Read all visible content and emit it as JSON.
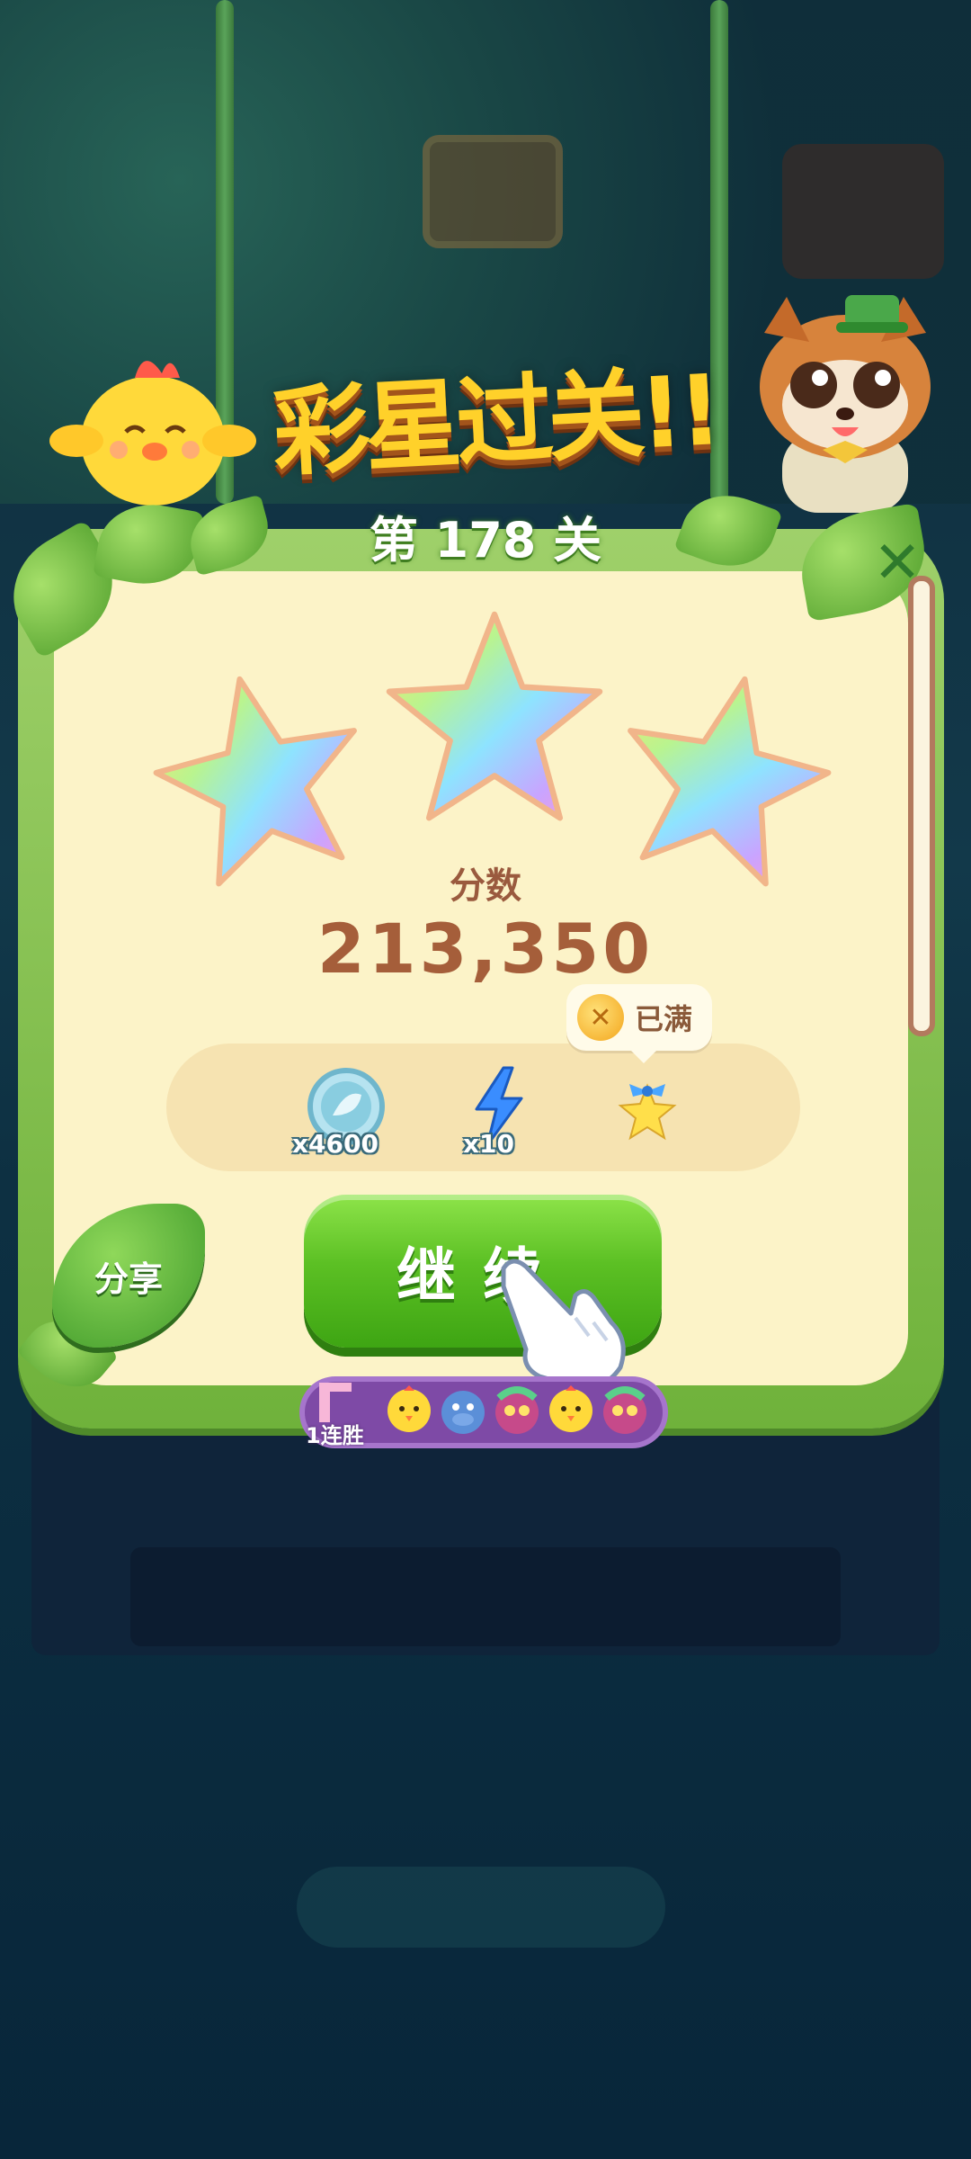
{
  "title": "彩星过关!!",
  "level": {
    "label": "第 178 关"
  },
  "score": {
    "label": "分数",
    "value": "213,350"
  },
  "rewards": [
    {
      "icon": "leaf-coin-icon",
      "count": "x4600"
    },
    {
      "icon": "lightning-icon",
      "count": "x10"
    },
    {
      "icon": "star-bow-icon",
      "count": ""
    }
  ],
  "tooltip": {
    "icon": "coin-icon",
    "text": "已满"
  },
  "buttons": {
    "continue": "继续",
    "share": "分享",
    "close": "✕"
  },
  "streak": {
    "label": "1连胜"
  },
  "stars_earned": 3,
  "colors": {
    "panel_bg": "#fcf3c8",
    "panel_border": "#6fb23b",
    "button_green": "#5cc024",
    "title_gold": "#ffd12a",
    "score_brown": "#a55e3a"
  }
}
